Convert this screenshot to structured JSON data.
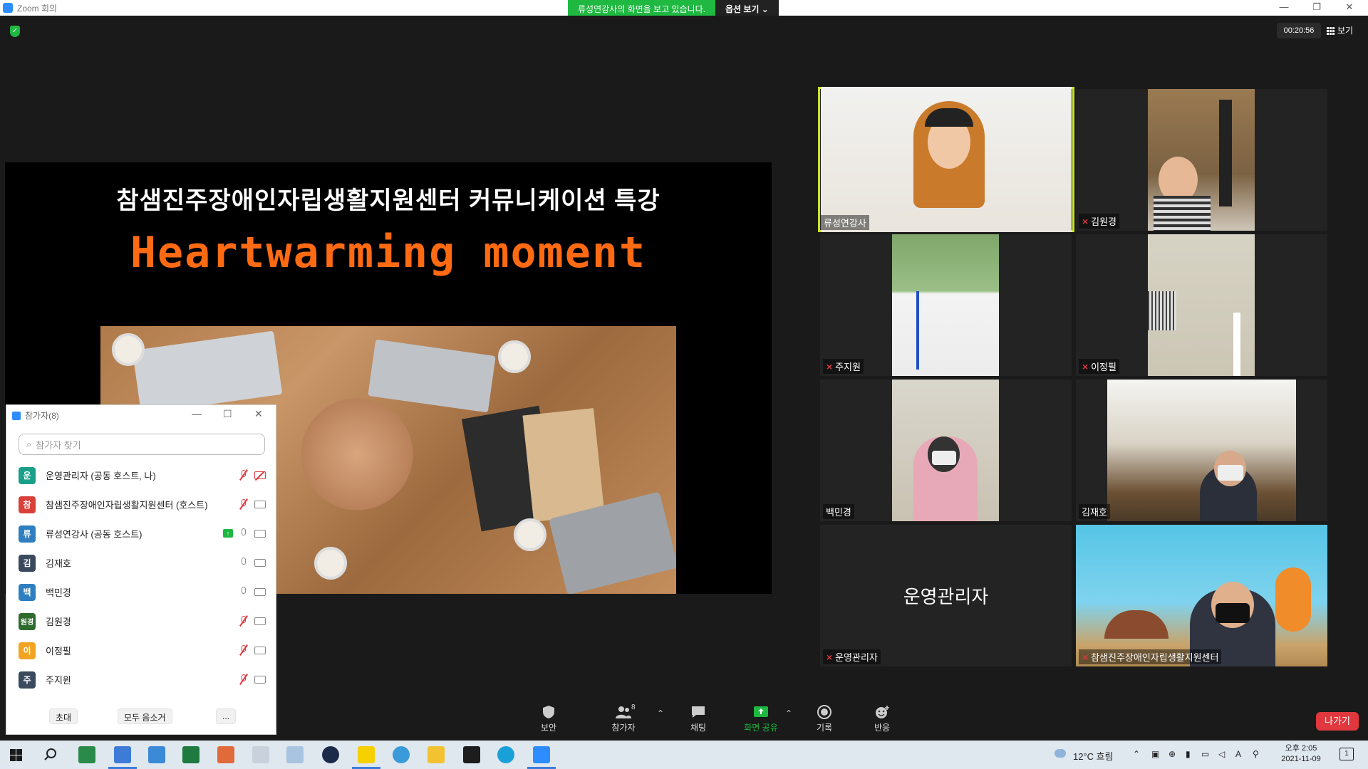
{
  "window": {
    "title": "Zoom 회의",
    "share_message": "류성연강사의 화면을 보고 있습니다.",
    "options_label": "옵션 보기 ⌄",
    "controls": [
      "—",
      "❐",
      "✕"
    ]
  },
  "meeting": {
    "timer": "00:20:56",
    "view_label": "보기"
  },
  "slide": {
    "heading": "참샘진주장애인자립생활지원센터 커뮤니케이션 특강",
    "subtitle": "Heartwarming moment"
  },
  "videos": [
    {
      "name": "류성연강사",
      "muted": false,
      "active": true
    },
    {
      "name": "김원경",
      "muted": true
    },
    {
      "name": "주지원",
      "muted": true
    },
    {
      "name": "이정필",
      "muted": true
    },
    {
      "name": "백민경",
      "muted": false
    },
    {
      "name": "김재호",
      "muted": false
    },
    {
      "name": "운영관리자",
      "muted": true,
      "big_label": "운영관리자"
    },
    {
      "name": "참샘진주장애인자립생활지원센터",
      "muted": true
    }
  ],
  "participants_panel": {
    "title": "참가자(8)",
    "search_placeholder": "참가자 찾기",
    "rows": [
      {
        "initial": "운",
        "color": "#1aa08a",
        "name": "운영관리자 (공동 호스트, 나)",
        "mic": "muted",
        "cam": "off",
        "sharing": false
      },
      {
        "initial": "참",
        "color": "#d9403a",
        "name": "참샘진주장애인자립생활지원센터 (호스트)",
        "mic": "muted",
        "cam": "on",
        "sharing": false
      },
      {
        "initial": "류",
        "color": "#2f7fc0",
        "name": "류성연강사 (공동 호스트)",
        "mic": "on",
        "cam": "on",
        "sharing": true
      },
      {
        "initial": "김",
        "color": "#3a4a5c",
        "name": "김재호",
        "mic": "on",
        "cam": "on",
        "sharing": false
      },
      {
        "initial": "백",
        "color": "#2f7fc0",
        "name": "백민경",
        "mic": "on",
        "cam": "on",
        "sharing": false
      },
      {
        "initial": "원경",
        "color": "#2e6b2e",
        "name": "김원경",
        "mic": "muted",
        "cam": "on",
        "sharing": false
      },
      {
        "initial": "이",
        "color": "#f2a421",
        "name": "이정필",
        "mic": "muted",
        "cam": "on",
        "sharing": false
      },
      {
        "initial": "주",
        "color": "#3a4a5c",
        "name": "주지원",
        "mic": "muted",
        "cam": "on",
        "sharing": false
      }
    ],
    "invite_label": "초대",
    "mute_all_label": "모두 음소거",
    "more_label": "..."
  },
  "toolbar": {
    "security": "보안",
    "participants": "참가자",
    "participants_count": "8",
    "chat": "채팅",
    "share": "화면 공유",
    "record": "기록",
    "reactions": "반응",
    "leave": "나가기"
  },
  "taskbar": {
    "weather": "12°C  흐림",
    "time": "오후 2:05",
    "date": "2021-11-09",
    "notification_count": "1"
  },
  "colors": {
    "zoom_blue": "#2d8cff",
    "share_green": "#1fb841",
    "leave_red": "#e0383e",
    "slide_orange": "#ff6a13",
    "active_speaker": "#c8e32a"
  }
}
